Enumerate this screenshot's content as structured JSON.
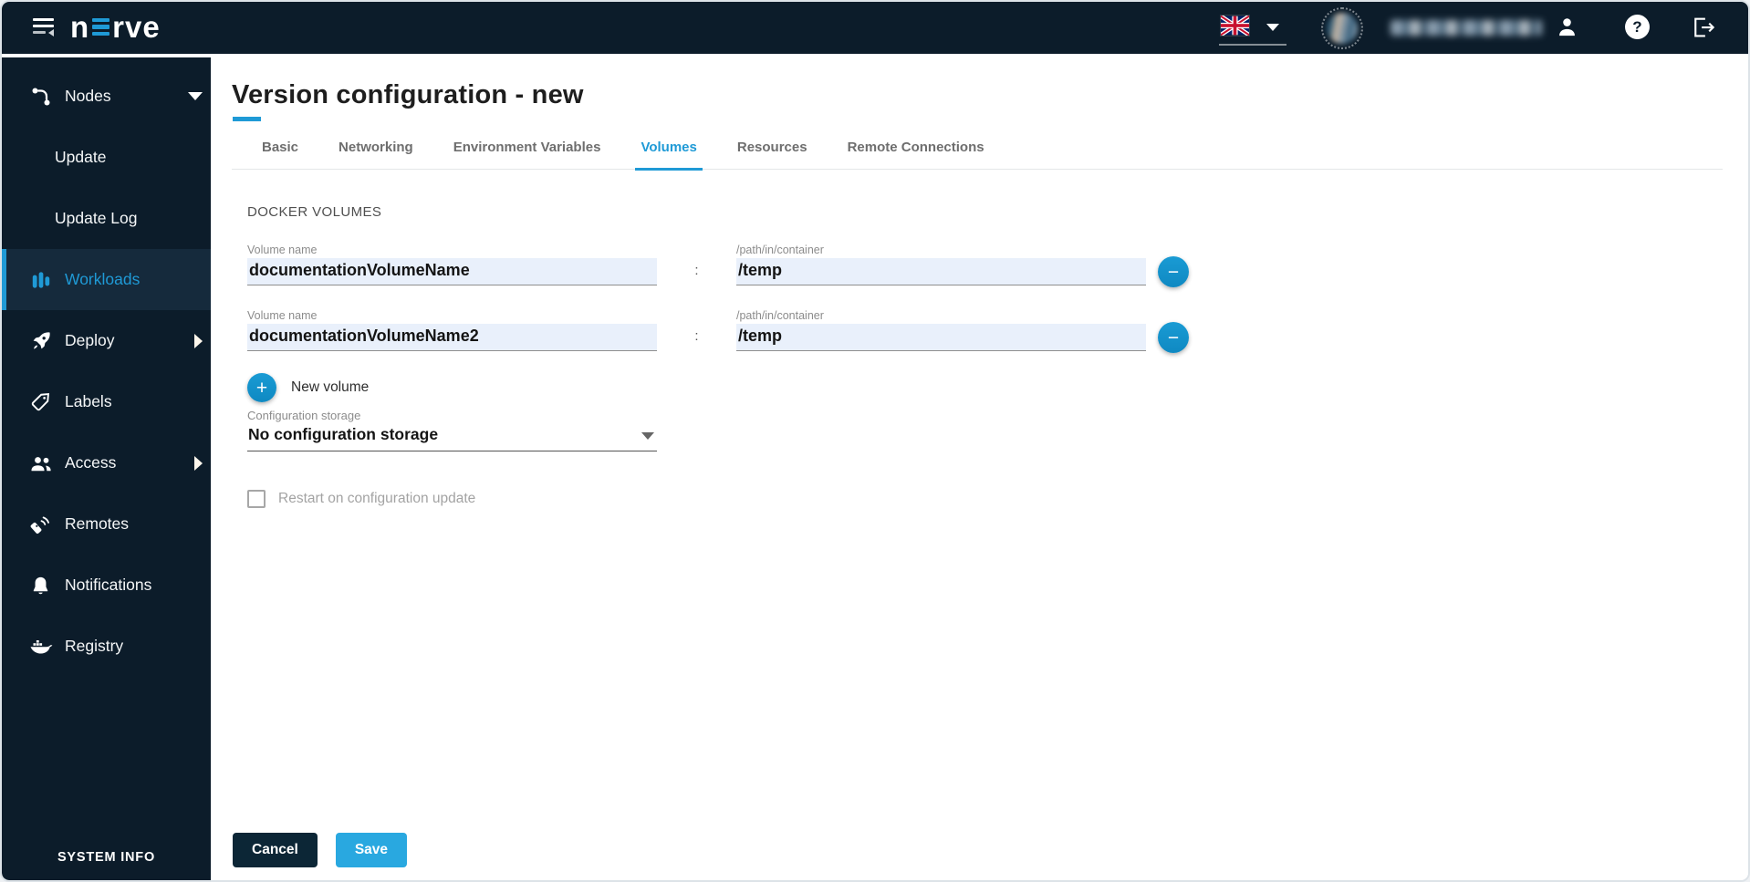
{
  "topbar": {
    "brand": {
      "prefix": "n",
      "suffix": "rve"
    },
    "language": {
      "flag": "union-jack"
    }
  },
  "sidebar": {
    "items": [
      {
        "label": "Nodes",
        "icon": "nodes-icon",
        "chevron": "down",
        "active": false
      },
      {
        "label": "Update",
        "sub": true,
        "active": false
      },
      {
        "label": "Update Log",
        "sub": true,
        "active": false
      },
      {
        "label": "Workloads",
        "icon": "workloads-icon",
        "active": true
      },
      {
        "label": "Deploy",
        "icon": "rocket-icon",
        "chevron": "right",
        "active": false
      },
      {
        "label": "Labels",
        "icon": "tag-icon",
        "active": false
      },
      {
        "label": "Access",
        "icon": "people-icon",
        "chevron": "right",
        "active": false
      },
      {
        "label": "Remotes",
        "icon": "remote-icon",
        "active": false
      },
      {
        "label": "Notifications",
        "icon": "bell-icon",
        "active": false
      },
      {
        "label": "Registry",
        "icon": "docker-icon",
        "active": false
      }
    ],
    "footer_label": "SYSTEM INFO"
  },
  "page": {
    "title": "Version configuration - new",
    "tabs": [
      {
        "label": "Basic",
        "active": false
      },
      {
        "label": "Networking",
        "active": false
      },
      {
        "label": "Environment Variables",
        "active": false
      },
      {
        "label": "Volumes",
        "active": true
      },
      {
        "label": "Resources",
        "active": false
      },
      {
        "label": "Remote Connections",
        "active": false
      }
    ],
    "docker_volumes": {
      "section_title": "DOCKER VOLUMES",
      "separator": ":",
      "rows": [
        {
          "name_label": "Volume name",
          "name_value": "documentationVolumeName",
          "path_label": "/path/in/container",
          "path_value": "/temp"
        },
        {
          "name_label": "Volume name",
          "name_value": "documentationVolumeName2",
          "path_label": "/path/in/container",
          "path_value": "/temp"
        }
      ],
      "new_volume_label": "New volume",
      "configuration_storage": {
        "label": "Configuration storage",
        "value": "No configuration storage"
      },
      "restart_checkbox": {
        "label": "Restart on configuration update",
        "checked": false,
        "disabled": true
      }
    },
    "actions": {
      "cancel_label": "Cancel",
      "save_label": "Save"
    }
  },
  "glyphs": {
    "minus": "−",
    "plus": "+",
    "help": "?"
  },
  "icons": {
    "menu": "hamburger-collapse",
    "nodes": "node-link",
    "workloads": "vertical-bars",
    "deploy": "rocket",
    "labels": "tag",
    "access": "two-people",
    "remotes": "remote-control",
    "notifications": "bell",
    "registry": "docker-whale",
    "language": "union-jack-flag",
    "account": "person-silhouette",
    "help": "question-mark-circle",
    "logout": "exit-arrow",
    "remove_row": "minus-circle",
    "add_row": "plus-circle",
    "dropdown": "caret-down"
  },
  "colors": {
    "accent": "#1f9ad6",
    "dark_navy": "#0c1c2a",
    "active_item_bg": "#152a3c",
    "save_button": "#29a8e0",
    "cancel_button": "#0c2636",
    "round_button": "#1392cc",
    "input_bg": "#e9f0fb"
  }
}
